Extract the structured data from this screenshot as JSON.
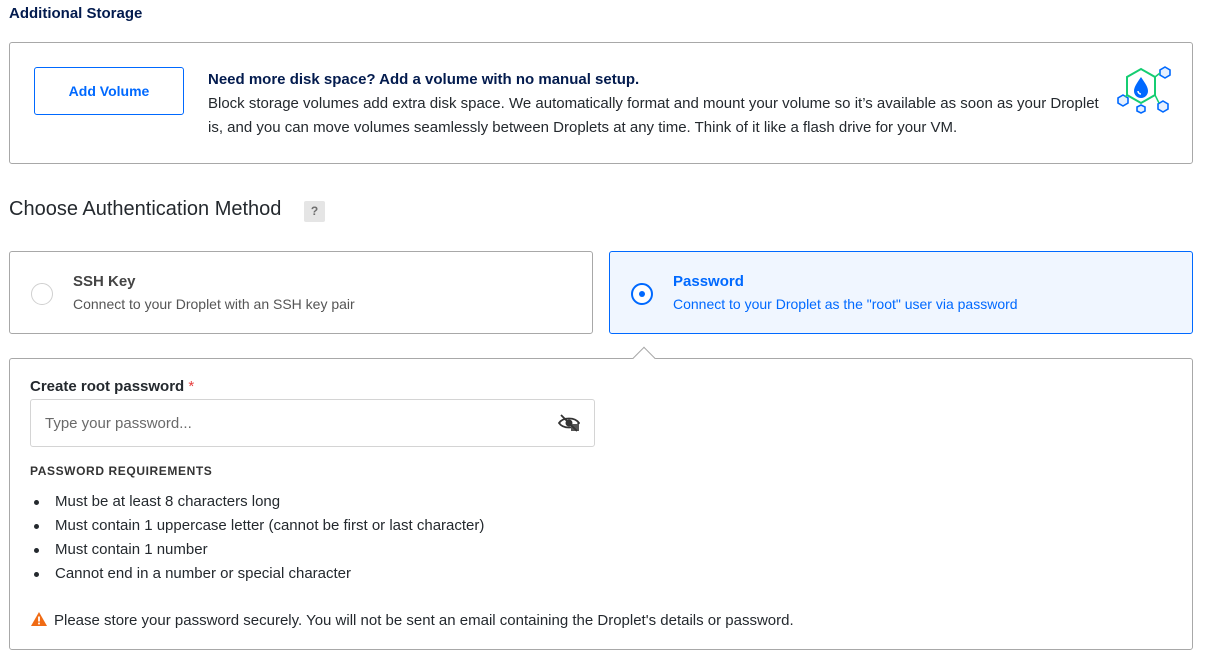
{
  "storage": {
    "section_title": "Additional Storage",
    "add_volume_label": "Add Volume",
    "headline": "Need more disk space? Add a volume with no manual setup.",
    "description": "Block storage volumes add extra disk space. We automatically format and mount your volume so it’s available as soon as your Droplet is, and you can move volumes seamlessly between Droplets at any time. Think of it like a flash drive for your VM.",
    "icon": "volume-droplet-icon"
  },
  "auth": {
    "title": "Choose Authentication Method",
    "help_label": "?",
    "options": [
      {
        "title": "SSH Key",
        "subtitle": "Connect to your Droplet with an SSH key pair",
        "selected": false
      },
      {
        "title": "Password",
        "subtitle": "Connect to your Droplet as the \"root\" user via password",
        "selected": true
      }
    ]
  },
  "password": {
    "label": "Create root password",
    "required_marker": "*",
    "placeholder": "Type your password...",
    "value": "",
    "toggle_icon": "eye-slash-icon",
    "requirements_heading": "PASSWORD REQUIREMENTS",
    "requirements": [
      "Must be at least 8 characters long",
      "Must contain 1 uppercase letter (cannot be first or last character)",
      "Must contain 1 number",
      "Cannot end in a number or special character"
    ],
    "warning": "Please store your password securely. You will not be sent an email containing the Droplet's details or password.",
    "warning_icon": "warning-triangle-icon"
  },
  "colors": {
    "accent": "#0069ff",
    "selected_bg": "#f0f6ff",
    "border": "#a8a8a8",
    "warning": "#f06b14",
    "required": "#e53e3e"
  }
}
